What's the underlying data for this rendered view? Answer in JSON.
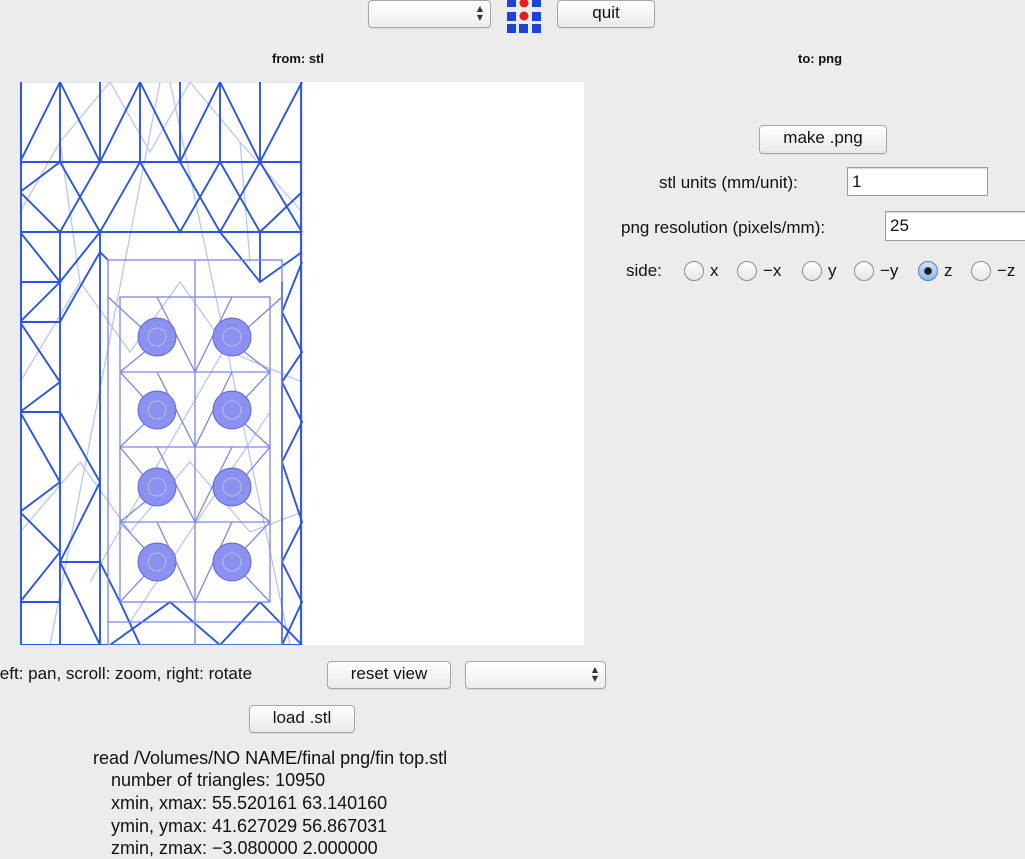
{
  "toolbar": {
    "format_select_value": "",
    "quit_label": "quit",
    "logo_icon": "grid-logo-icon"
  },
  "panels": {
    "from_label": "from: stl",
    "to_label": "to: png"
  },
  "viewer": {
    "hint": "left: pan, scroll: zoom, right: rotate",
    "reset_label": "reset view",
    "view_select_value": "",
    "load_label": "load .stl"
  },
  "settings": {
    "make_label": "make .png",
    "units_label": "stl units (mm/unit):",
    "units_value": "1",
    "resolution_label": "png resolution (pixels/mm):",
    "resolution_value": "25",
    "side_label": "side:",
    "sides": [
      {
        "label": "x",
        "checked": false
      },
      {
        "label": "−x",
        "checked": false
      },
      {
        "label": "y",
        "checked": false
      },
      {
        "label": "−y",
        "checked": false
      },
      {
        "label": "z",
        "checked": true
      },
      {
        "label": "−z",
        "checked": false
      }
    ]
  },
  "info": {
    "read_line": "read /Volumes/NO NAME/final png/fin top.stl",
    "triangles_line": "number of triangles: 10950",
    "x_line": "xmin, xmax: 55.520161 63.140160",
    "y_line": "ymin, ymax: 41.627029 56.867031",
    "z_line": "zmin, zmax: −3.080000 2.000000"
  },
  "colors": {
    "mesh": "#2a55e0",
    "mesh_light": "#b9c6f2",
    "logo_blue": "#1c45d6",
    "logo_red": "#e02020"
  }
}
